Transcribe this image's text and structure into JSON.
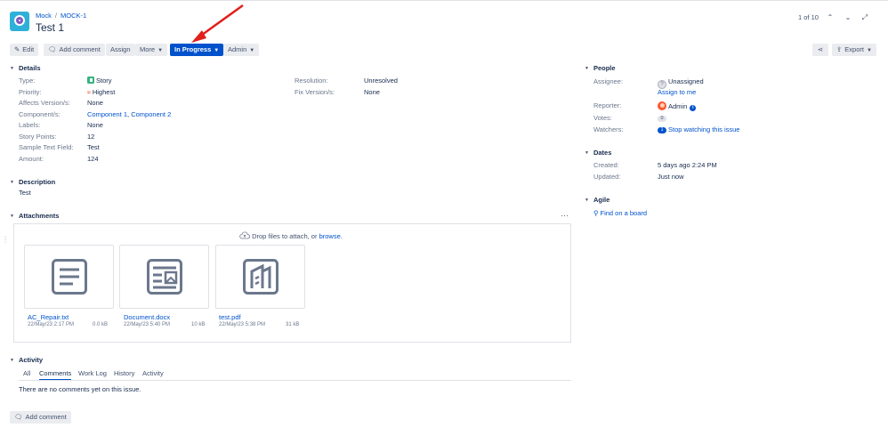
{
  "breadcrumb": {
    "project": "Mock",
    "separator": "/",
    "issue_key": "MOCK-1"
  },
  "issue": {
    "title": "Test 1"
  },
  "pager": {
    "text": "1 of 10"
  },
  "toolbar": {
    "edit": "Edit",
    "add_comment": "Add comment",
    "assign": "Assign",
    "more": "More",
    "status": "In Progress",
    "admin": "Admin",
    "export": "Export"
  },
  "details": {
    "heading": "Details",
    "type_label": "Type:",
    "type_value": "Story",
    "priority_label": "Priority:",
    "priority_value": "Highest",
    "affects_label": "Affects Version/s:",
    "affects_value": "None",
    "components_label": "Component/s:",
    "component1": "Component 1",
    "component_sep": ",",
    "component2": "Component 2",
    "labels_label": "Labels:",
    "labels_value": "None",
    "story_points_label": "Story Points:",
    "story_points_value": "12",
    "sample_text_label": "Sample Text Field:",
    "sample_text_value": "Test",
    "amount_label": "Amount:",
    "amount_value": "124",
    "resolution_label": "Resolution:",
    "resolution_value": "Unresolved",
    "fix_label": "Fix Version/s:",
    "fix_value": "None"
  },
  "description": {
    "heading": "Description",
    "text": "Test"
  },
  "attachments": {
    "heading": "Attachments",
    "more": "···",
    "drop_text": "Drop files to attach, or",
    "browse": "browse.",
    "files": [
      {
        "name": "AC_Repair.txt",
        "date": "22/May/23 2:17 PM",
        "size": "0.0 kB"
      },
      {
        "name": "Document.docx",
        "date": "22/May/23 5:40 PM",
        "size": "10 kB"
      },
      {
        "name": "test.pdf",
        "date": "22/May/23 5:38 PM",
        "size": "31 kB"
      }
    ]
  },
  "activity": {
    "heading": "Activity",
    "tabs": [
      "All",
      "Comments",
      "Work Log",
      "History",
      "Activity"
    ],
    "active_tab": "Comments",
    "empty": "There are no comments yet on this issue.",
    "add_comment": "Add comment"
  },
  "people": {
    "heading": "People",
    "assignee_label": "Assignee:",
    "assignee_value": "Unassigned",
    "assign_to_me": "Assign to me",
    "reporter_label": "Reporter:",
    "reporter_value": "Admin",
    "votes_label": "Votes:",
    "votes_value": "0",
    "watchers_label": "Watchers:",
    "watchers_value": "1",
    "stop_watching": "Stop watching this issue"
  },
  "dates": {
    "heading": "Dates",
    "created_label": "Created:",
    "created_value": "5 days ago 2:24 PM",
    "updated_label": "Updated:",
    "updated_value": "Just now"
  },
  "agile": {
    "heading": "Agile",
    "find_board": "Find on a board"
  },
  "colors": {
    "primary": "#0052cc",
    "button_bg": "#ebecf0",
    "arrow": "#e0201b"
  }
}
